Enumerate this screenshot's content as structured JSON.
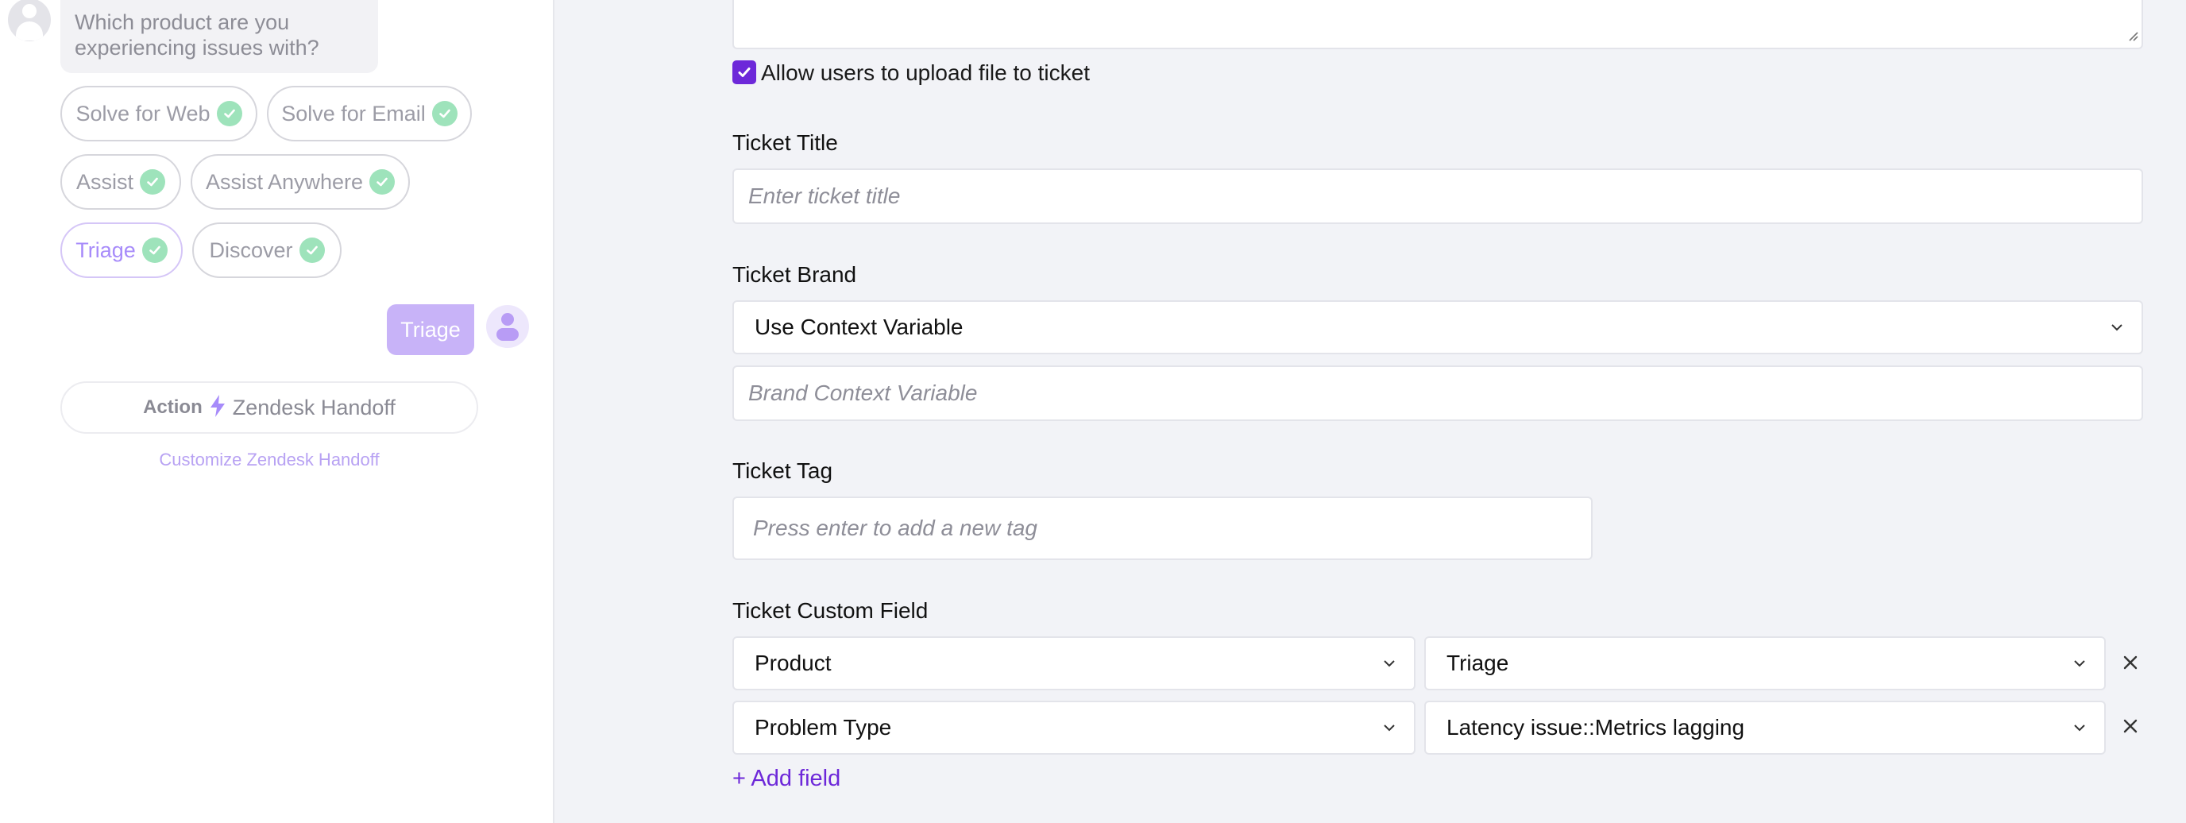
{
  "chat_preview": {
    "bot_message": "Which product are you experiencing issues with?",
    "options": [
      {
        "label": "Solve for Web",
        "selected": false
      },
      {
        "label": "Solve for Email",
        "selected": false
      },
      {
        "label": "Assist",
        "selected": false
      },
      {
        "label": "Assist Anywhere",
        "selected": false
      },
      {
        "label": "Triage",
        "selected": true
      },
      {
        "label": "Discover",
        "selected": false
      }
    ],
    "user_reply": "Triage",
    "action": {
      "label": "Action",
      "icon": "lightning-icon",
      "name": "Zendesk Handoff"
    },
    "customize_link": "Customize Zendesk Handoff"
  },
  "form": {
    "upload_checkbox": {
      "label": "Allow users to upload file to ticket",
      "checked": true
    },
    "ticket_title": {
      "label": "Ticket Title",
      "placeholder": "Enter ticket title"
    },
    "ticket_brand": {
      "label": "Ticket Brand",
      "selected": "Use Context Variable",
      "variable_placeholder": "Brand Context Variable"
    },
    "ticket_tag": {
      "label": "Ticket Tag",
      "placeholder": "Press enter to add a new tag"
    },
    "custom_fields": {
      "label": "Ticket Custom Field",
      "rows": [
        {
          "field": "Product",
          "value": "Triage"
        },
        {
          "field": "Problem Type",
          "value": "Latency issue::Metrics lagging"
        }
      ],
      "add_label": "+ Add field"
    }
  },
  "colors": {
    "accent": "#6d28d9",
    "accent_light": "#c8b3f8",
    "check_green": "#9ee3bb",
    "page_bg": "#f2f3f7"
  }
}
